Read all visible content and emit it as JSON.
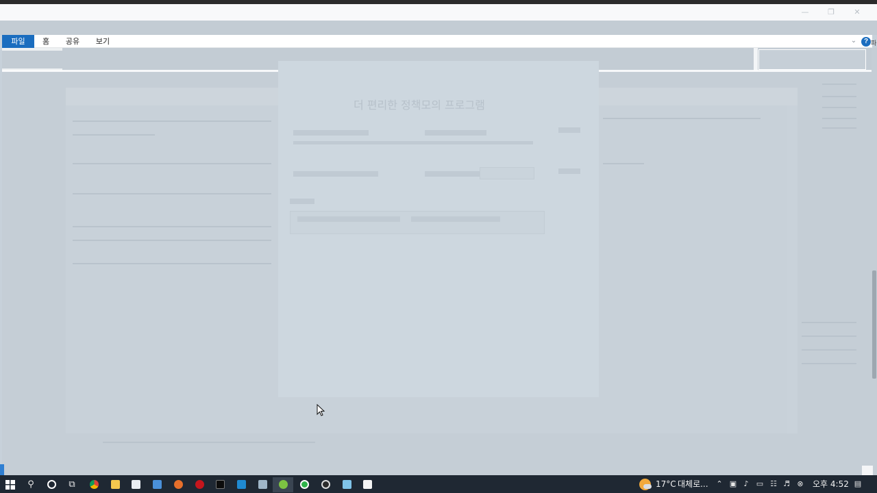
{
  "window": {
    "controls": {
      "minimize": "—",
      "maximize": "❐",
      "close": "✕"
    }
  },
  "ribbon": {
    "tabs": [
      {
        "label": "파일",
        "active": true
      },
      {
        "label": "홈"
      },
      {
        "label": "공유"
      },
      {
        "label": "보기"
      }
    ],
    "help": "?",
    "edge_char": "파"
  },
  "dialog": {
    "title": "더 편리한 정책모의 프로그램"
  },
  "taskbar": {
    "start_icon": "windows-icon",
    "icons": [
      "search-icon",
      "cortana-icon",
      "task-view-icon",
      "chrome-icon",
      "file-explorer-icon",
      "store-icon",
      "mail-icon",
      "firefox-icon",
      "opera-icon",
      "terminal-icon",
      "vscode-icon",
      "remote-desktop-icon",
      "clover-icon",
      "green-app-icon",
      "obs-icon",
      "notepad-icon",
      "document-icon"
    ],
    "weather": {
      "temp": "17°C",
      "text": "대체로..."
    },
    "clock": "오후 4:52",
    "colors": {
      "taskbar": "#1f2833",
      "accent": "#1a6dbf"
    }
  }
}
